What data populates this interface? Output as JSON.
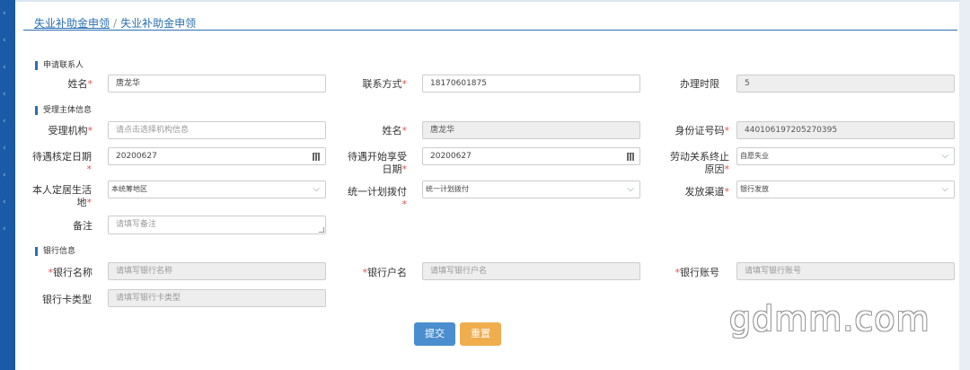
{
  "breadcrumb": {
    "parent": "失业补助金申领",
    "separator": "/",
    "current": "失业补助金申领"
  },
  "sections": {
    "applicant": "申请联系人",
    "subject": "受理主体信息",
    "bank": "银行信息"
  },
  "applicant": {
    "name_label": "姓名",
    "name_value": "唐龙华",
    "contact_label": "联系方式",
    "contact_value": "18170601875",
    "duration_label": "办理时限",
    "duration_value": "5"
  },
  "subject": {
    "agency_label": "受理机构",
    "agency_placeholder": "请点击选择机构信息",
    "name_label": "姓名",
    "name_value": "唐龙华",
    "id_label": "身份证号码",
    "id_value": "440106197205270395",
    "approve_date_label_1": "待遇核定日期",
    "approve_date_value": "20200627",
    "start_date_label_1": "待遇开始享受",
    "start_date_label_2": "日期",
    "start_date_value": "20200627",
    "termination_label_1": "劳动关系终止",
    "termination_label_2": "原因",
    "termination_value": "自愿失业",
    "residence_label_1": "本人定居生活",
    "residence_label_2": "地",
    "residence_value": "本统筹地区",
    "allocation_label": "统一计划拨付",
    "allocation_value": "统一计划拨付",
    "channel_label": "发放渠道",
    "channel_value": "银行发放",
    "remark_label": "备注",
    "remark_placeholder": "请填写备注"
  },
  "bank": {
    "bank_name_label": "银行名称",
    "bank_name_placeholder": "请填写银行名称",
    "account_name_label": "银行户名",
    "account_name_placeholder": "请填写银行户名",
    "account_no_label": "银行账号",
    "account_no_placeholder": "请填写银行账号",
    "card_type_label": "银行卡类型",
    "card_type_placeholder": "请填写银行卡类型"
  },
  "actions": {
    "submit": "提交",
    "reset": "重置"
  },
  "required_mark": "*",
  "watermark": "gdmm.com",
  "colors": {
    "accent": "#2a6fb3",
    "submit": "#4a8ed0",
    "reset": "#f0ad4e",
    "required": "#d9534f",
    "sidebar": "#1a5aa6"
  }
}
